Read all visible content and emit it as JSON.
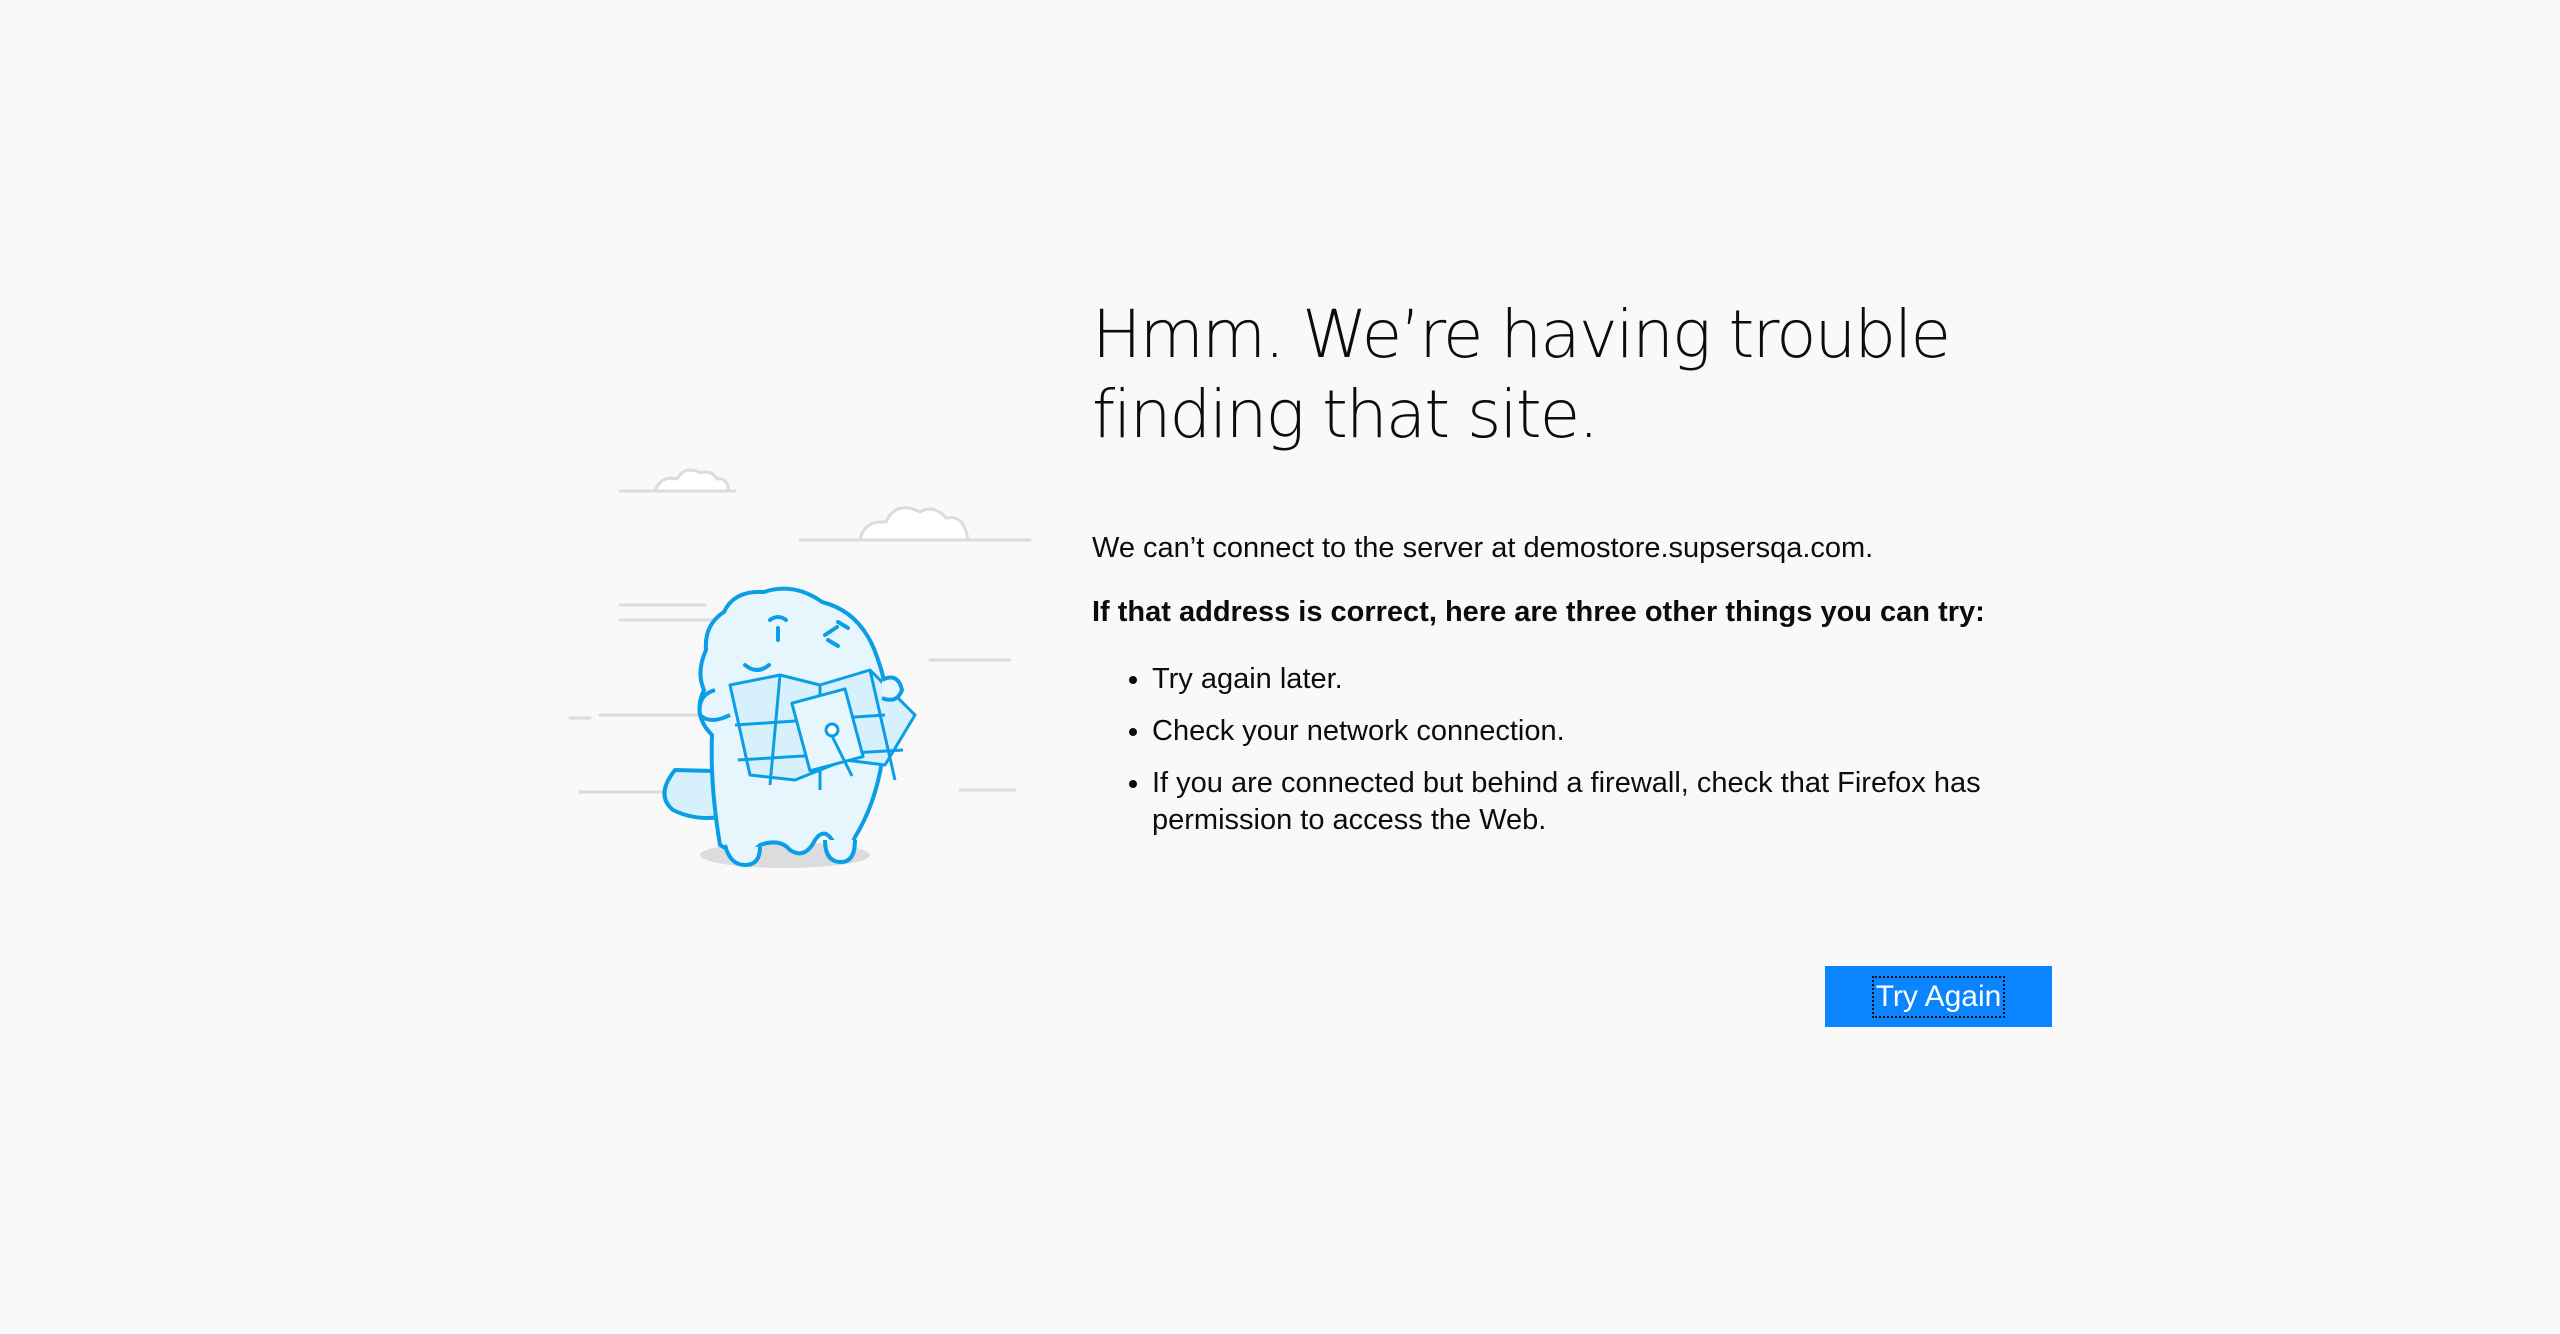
{
  "error_page": {
    "title": "Hmm. We’re having trouble finding that site.",
    "description": "We can’t connect to the server at demostore.supsersqa.com.",
    "subtitle": "If that address is correct, here are three other things you can try:",
    "tips": [
      "Try again later.",
      "Check your network connection.",
      "If you are connected but behind a firewall, check that Firefox has permission to access the Web."
    ],
    "button_label": "Try Again"
  },
  "colors": {
    "background": "#f9f9fa",
    "button": "#0a84ff",
    "illustration_stroke": "#0a9ee6",
    "illustration_fill": "#d6f0fc"
  },
  "icons": {
    "illustration": "lost-monster-with-map-icon"
  }
}
